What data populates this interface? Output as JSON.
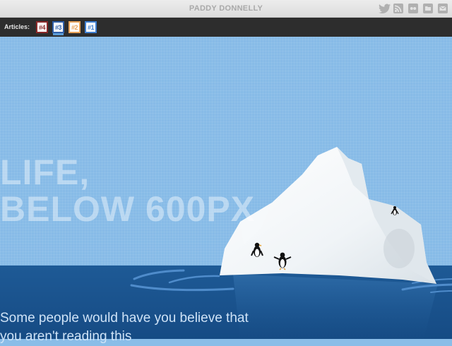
{
  "header": {
    "site_name": "PADDY DONNELLY"
  },
  "social_icons": [
    "twitter-icon",
    "rss-icon",
    "flickr-icon",
    "folder-icon",
    "mail-icon"
  ],
  "articles": {
    "label": "Articles:",
    "tabs": [
      {
        "label": "#4",
        "color": "#8b2a2a",
        "active": false
      },
      {
        "label": "#3",
        "color": "#2f5fa8",
        "active": true
      },
      {
        "label": "#2",
        "color": "#e8a35a",
        "active": false
      },
      {
        "label": "#1",
        "color": "#3f7fd0",
        "active": false
      }
    ]
  },
  "hero": {
    "headline_line1": "LIFE,",
    "headline_line2": "BELOW 600PX"
  },
  "intro": {
    "text": "Some people would have you believe that you aren't reading this"
  },
  "colors": {
    "sky": "#87bbe7",
    "sea": "#1e5a96",
    "topbar": "#e4e4e4",
    "articles_bar": "#2d2d2d"
  }
}
